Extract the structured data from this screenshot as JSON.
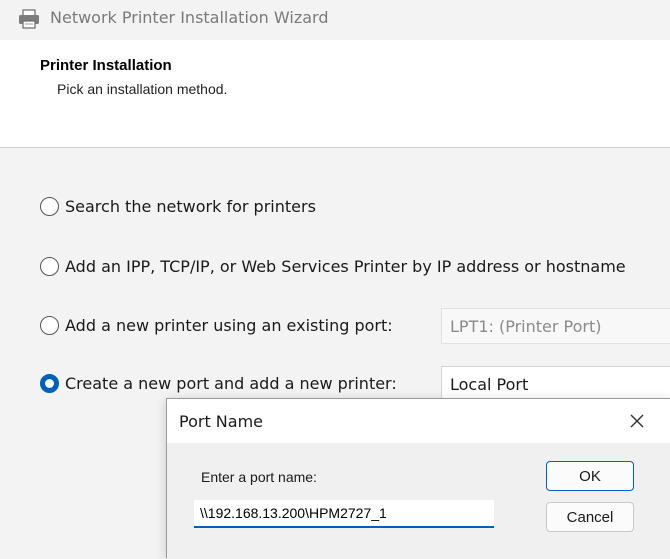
{
  "window": {
    "title": "Network Printer Installation Wizard",
    "icon": "printer-icon"
  },
  "header": {
    "title": "Printer Installation",
    "subtitle": "Pick an installation method."
  },
  "options": [
    {
      "label": "Search the network for printers",
      "checked": false
    },
    {
      "label": "Add an IPP, TCP/IP, or Web Services Printer by IP address or hostname",
      "checked": false
    },
    {
      "label": "Add a new printer using an existing port:",
      "checked": false,
      "port_value": "LPT1: (Printer Port)"
    },
    {
      "label": "Create a new port and add a new printer:",
      "checked": true,
      "port_value": "Local Port"
    }
  ],
  "dialog": {
    "title": "Port Name",
    "close_icon": "close-icon",
    "field_label": "Enter a port name:",
    "field_value": "\\\\192.168.13.200\\HPM2727_1",
    "ok_label": "OK",
    "cancel_label": "Cancel"
  },
  "colors": {
    "accent": "#0060c0",
    "window_bg": "#f3f3f3",
    "header_bg": "#ffffff",
    "disabled_text": "#8a8a8a"
  }
}
